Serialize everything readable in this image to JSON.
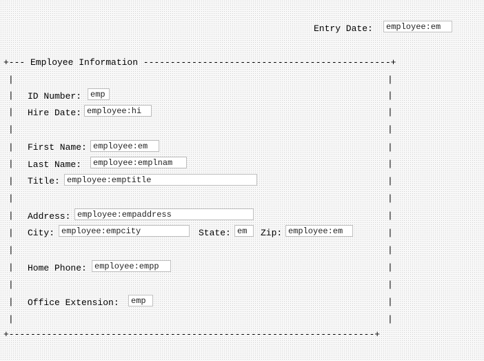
{
  "header": {
    "entry_date_label": "Entry Date:",
    "entry_date_value": "employee:em"
  },
  "group": {
    "title": "Employee Information",
    "top_left": "+--- ",
    "top_right_dashes": " ----------------------------------------------+",
    "side": "|",
    "bottom": "+--------------------------------------------------------------------+"
  },
  "form": {
    "id_label": "ID Number:",
    "id_value": "emp",
    "hire_label": "Hire Date:",
    "hire_value": "employee:hi",
    "first_label": "First Name:",
    "first_value": "employee:em",
    "last_label": "Last Name:",
    "last_value": "employee:emplnam",
    "title_label": "Title:",
    "title_value": "employee:emptitle",
    "address_label": "Address:",
    "address_value": "employee:empaddress",
    "city_label": "City:",
    "city_value": "employee:empcity",
    "state_label": "State:",
    "state_value": "em",
    "zip_label": "Zip:",
    "zip_value": "employee:em",
    "homephone_label": "Home Phone:",
    "homephone_value": "employee:empp",
    "ext_label": "Office Extension:",
    "ext_value": "emp"
  }
}
